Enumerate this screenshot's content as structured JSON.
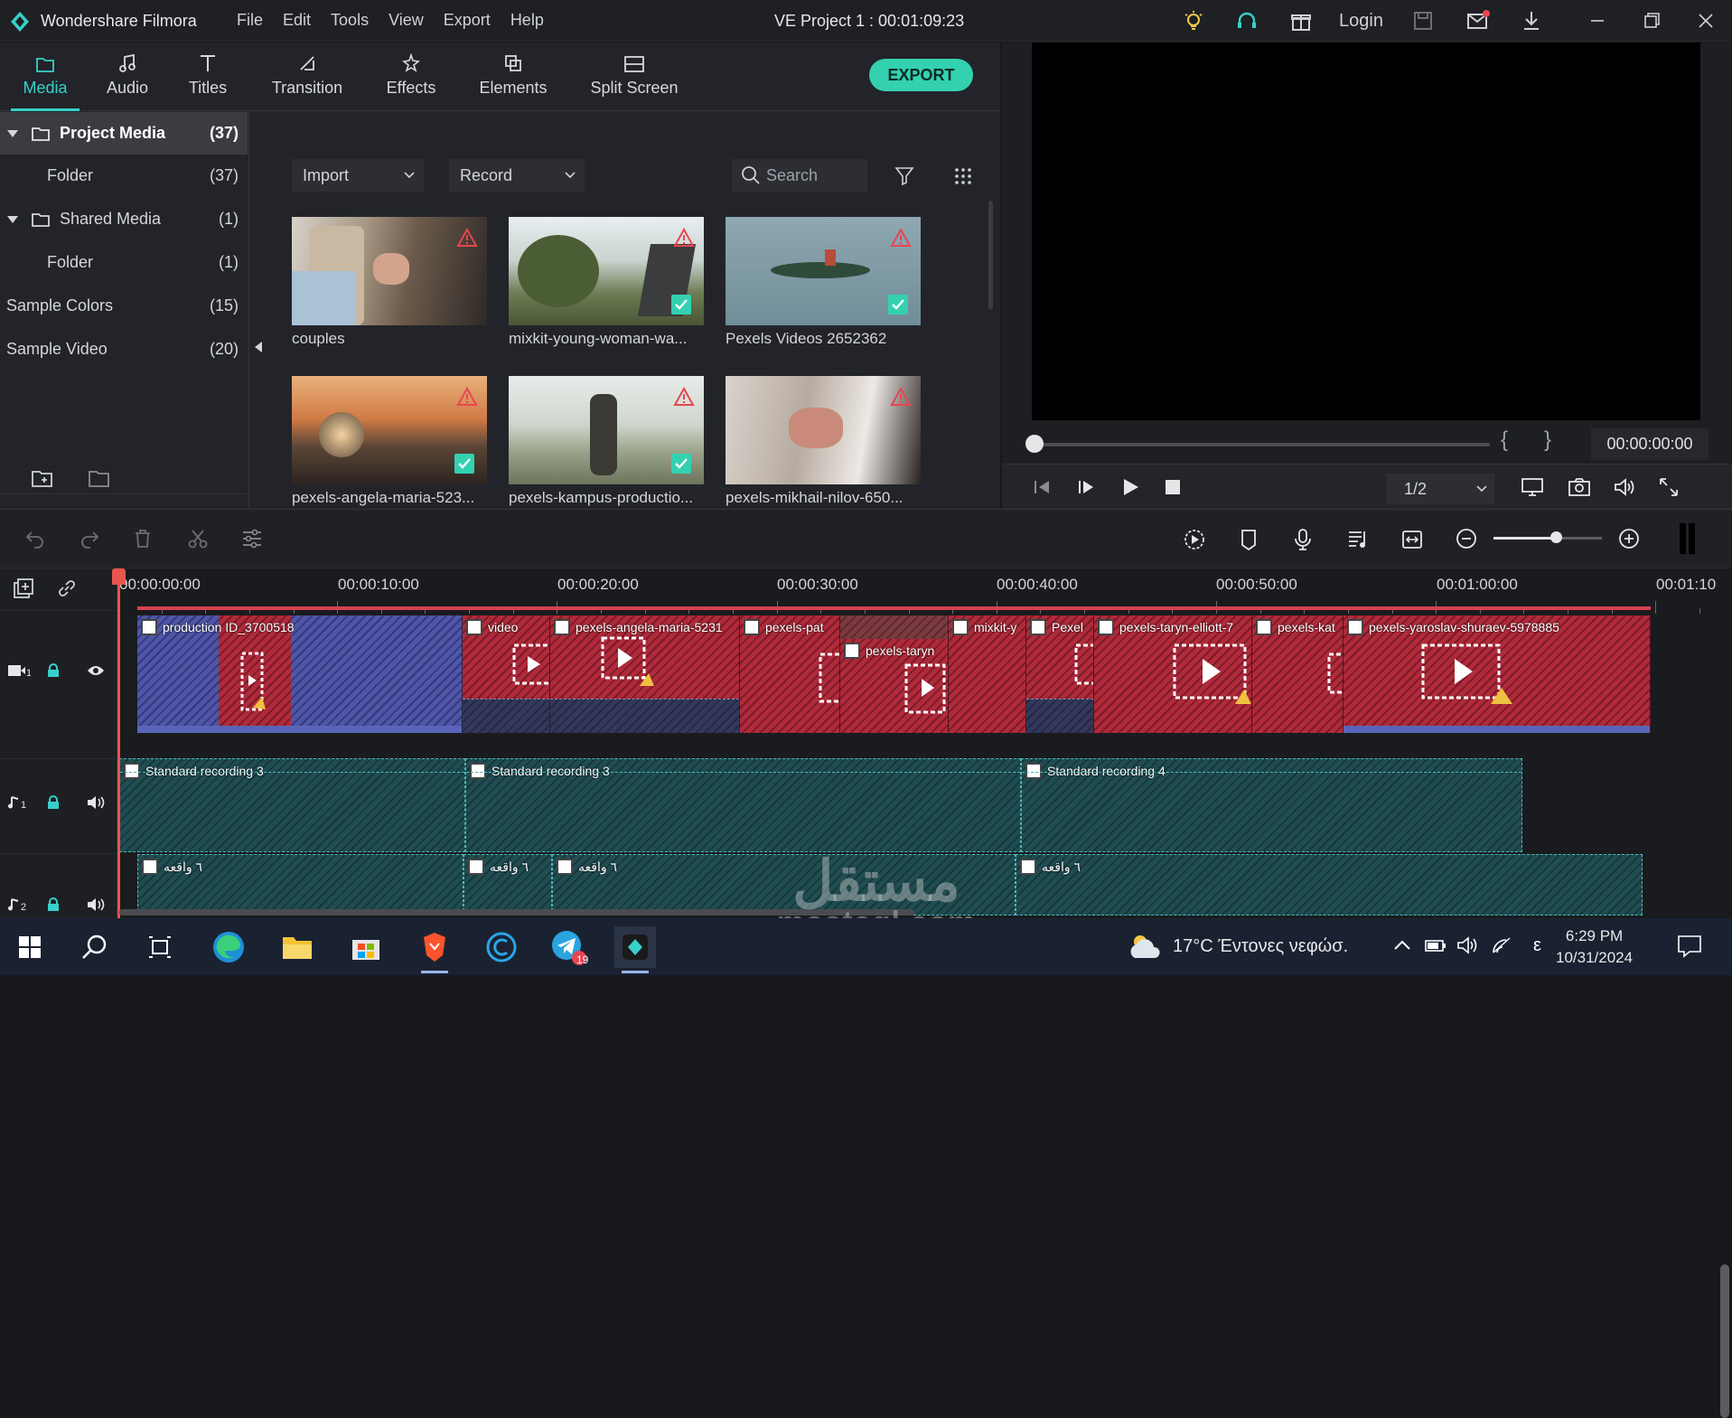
{
  "app": {
    "name": "Wondershare Filmora",
    "project_title": "VE Project 1 : 00:01:09:23",
    "login": "Login"
  },
  "menu": [
    "File",
    "Edit",
    "Tools",
    "View",
    "Export",
    "Help"
  ],
  "tabs": [
    {
      "label": "Media",
      "icon": "folder-icon",
      "active": true
    },
    {
      "label": "Audio",
      "icon": "music-note-icon"
    },
    {
      "label": "Titles",
      "icon": "text-t-icon"
    },
    {
      "label": "Transition",
      "icon": "transition-icon"
    },
    {
      "label": "Effects",
      "icon": "effects-icon"
    },
    {
      "label": "Elements",
      "icon": "elements-icon"
    },
    {
      "label": "Split Screen",
      "icon": "split-screen-icon"
    }
  ],
  "export_label": "EXPORT",
  "sidebar": [
    {
      "label": "Project Media",
      "count": "(37)",
      "selected": true,
      "expandable": true,
      "folder_icon": true
    },
    {
      "label": "Folder",
      "count": "(37)"
    },
    {
      "label": "Shared Media",
      "count": "(1)",
      "expandable": true,
      "folder_icon": true
    },
    {
      "label": "Folder",
      "count": "(1)"
    },
    {
      "label": "Sample Colors",
      "count": "(15)"
    },
    {
      "label": "Sample Video",
      "count": "(20)"
    }
  ],
  "media_toolbar": {
    "import": "Import",
    "record": "Record",
    "search_placeholder": "Search"
  },
  "media": [
    {
      "caption": "couples",
      "warning": true,
      "checked": false
    },
    {
      "caption": "mixkit-young-woman-wa...",
      "warning": true,
      "checked": true
    },
    {
      "caption": "Pexels Videos 2652362",
      "warning": true,
      "checked": true
    },
    {
      "caption": "pexels-angela-maria-523...",
      "warning": true,
      "checked": true
    },
    {
      "caption": "pexels-kampus-productio...",
      "warning": true,
      "checked": true
    },
    {
      "caption": "pexels-mikhail-nilov-650...",
      "warning": true,
      "checked": false
    }
  ],
  "preview": {
    "time": "00:00:00:00",
    "ratio": "1/2",
    "brace_open": "{",
    "brace_close": "}",
    "scrub_position": 0
  },
  "timeline": {
    "ruler": [
      "00:00:00:00",
      "00:00:10:00",
      "00:00:20:00",
      "00:00:30:00",
      "00:00:40:00",
      "00:00:50:00",
      "00:01:00:00",
      "00:01:10"
    ],
    "video_clips": [
      "production ID_3700518",
      "video",
      "pexels-angela-maria-5231",
      "pexels-pat",
      "pexels-taryn",
      "mixkit-y",
      "Pexel",
      "pexels-taryn-elliott-7",
      "pexels-kat",
      "pexels-yaroslav-shuraev-5978885"
    ],
    "audio1_clips": [
      "Standard recording 3",
      "Standard recording 3",
      "Standard recording 4"
    ],
    "audio2_clips": [
      "٦ واقعه",
      "٦ واقعه",
      "٦ واقعه",
      "٦ واقعه"
    ],
    "zoom_level": 0.6
  },
  "taskbar": {
    "weather": "17°C  Έντονες νεφώσ.",
    "time": "6:29 PM",
    "date": "10/31/2024",
    "lang": "ε",
    "telegram_badge": "19"
  },
  "watermark": {
    "arabic": "مستقل",
    "latin": "mostaql.com"
  },
  "colors": {
    "accent": "#38d0c9",
    "export": "#33d1b0",
    "video_clip": "#b02a3a",
    "blue_clip": "#4f56a8",
    "audio_clip": "#1f4d52",
    "playhead": "#e8554f"
  }
}
